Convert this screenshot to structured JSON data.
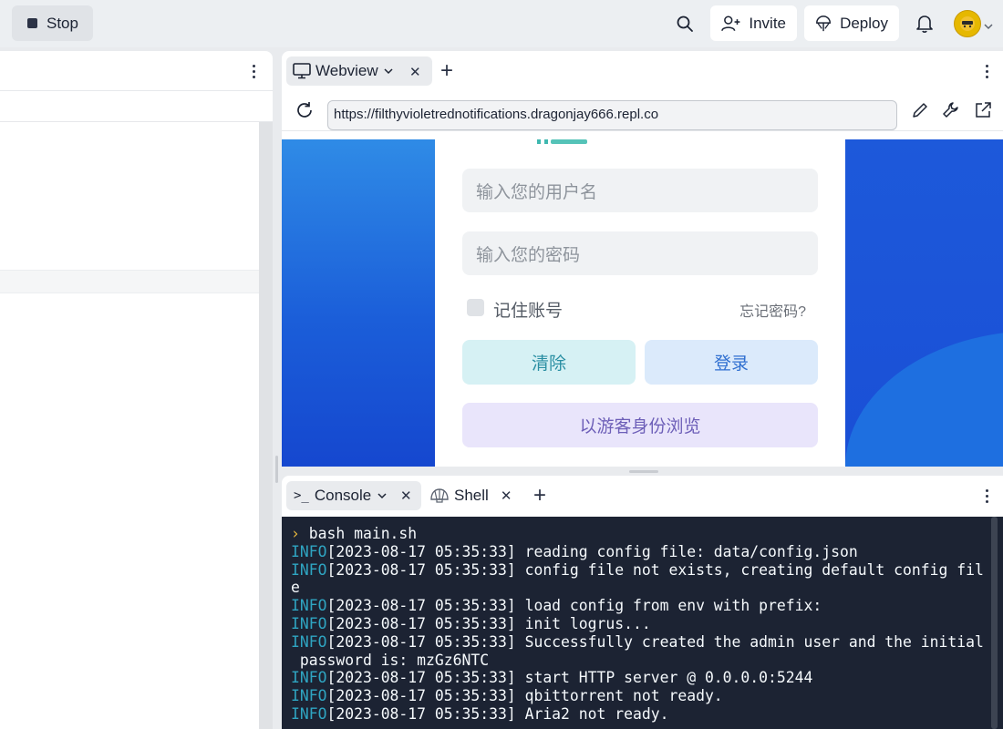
{
  "topbar": {
    "stop_label": "Stop",
    "invite_label": "Invite",
    "deploy_label": "Deploy",
    "icons": [
      "search-icon",
      "add-user-icon",
      "deploy-icon",
      "bell-icon",
      "avatar",
      "chevron-down-icon"
    ]
  },
  "webview": {
    "tab_label": "Webview",
    "url": "https://filthyvioletrednotifications.dragonjay666.repl.co",
    "site": {
      "username_placeholder": "输入您的用户名",
      "password_placeholder": "输入您的密码",
      "remember_label": "记住账号",
      "forgot_label": "忘记密码?",
      "clear_label": "清除",
      "login_label": "登录",
      "guest_label": "以游客身份浏览"
    }
  },
  "console": {
    "console_tab_label": "Console",
    "shell_tab_label": "Shell",
    "command_line": "bash main.sh",
    "lines": [
      {
        "level": "INFO",
        "text": "[2023-08-17 05:35:33] reading config file: data/config.json"
      },
      {
        "level": "INFO",
        "text": "[2023-08-17 05:35:33] config file not exists, creating default config fil\ne"
      },
      {
        "level": "INFO",
        "text": "[2023-08-17 05:35:33] load config from env with prefix:"
      },
      {
        "level": "INFO",
        "text": "[2023-08-17 05:35:33] init logrus..."
      },
      {
        "level": "INFO",
        "text": "[2023-08-17 05:35:33] Successfully created the admin user and the initial\n password is: mzGz6NTC"
      },
      {
        "level": "INFO",
        "text": "[2023-08-17 05:35:33] start HTTP server @ 0.0.0.0:5244"
      },
      {
        "level": "INFO",
        "text": "[2023-08-17 05:35:33] qbittorrent not ready."
      },
      {
        "level": "INFO",
        "text": "[2023-08-17 05:35:33] Aria2 not ready."
      }
    ]
  },
  "colors": {
    "terminal_bg": "#1c2333",
    "info": "#2fa5c2",
    "site_blue": "#1b5ed9"
  }
}
